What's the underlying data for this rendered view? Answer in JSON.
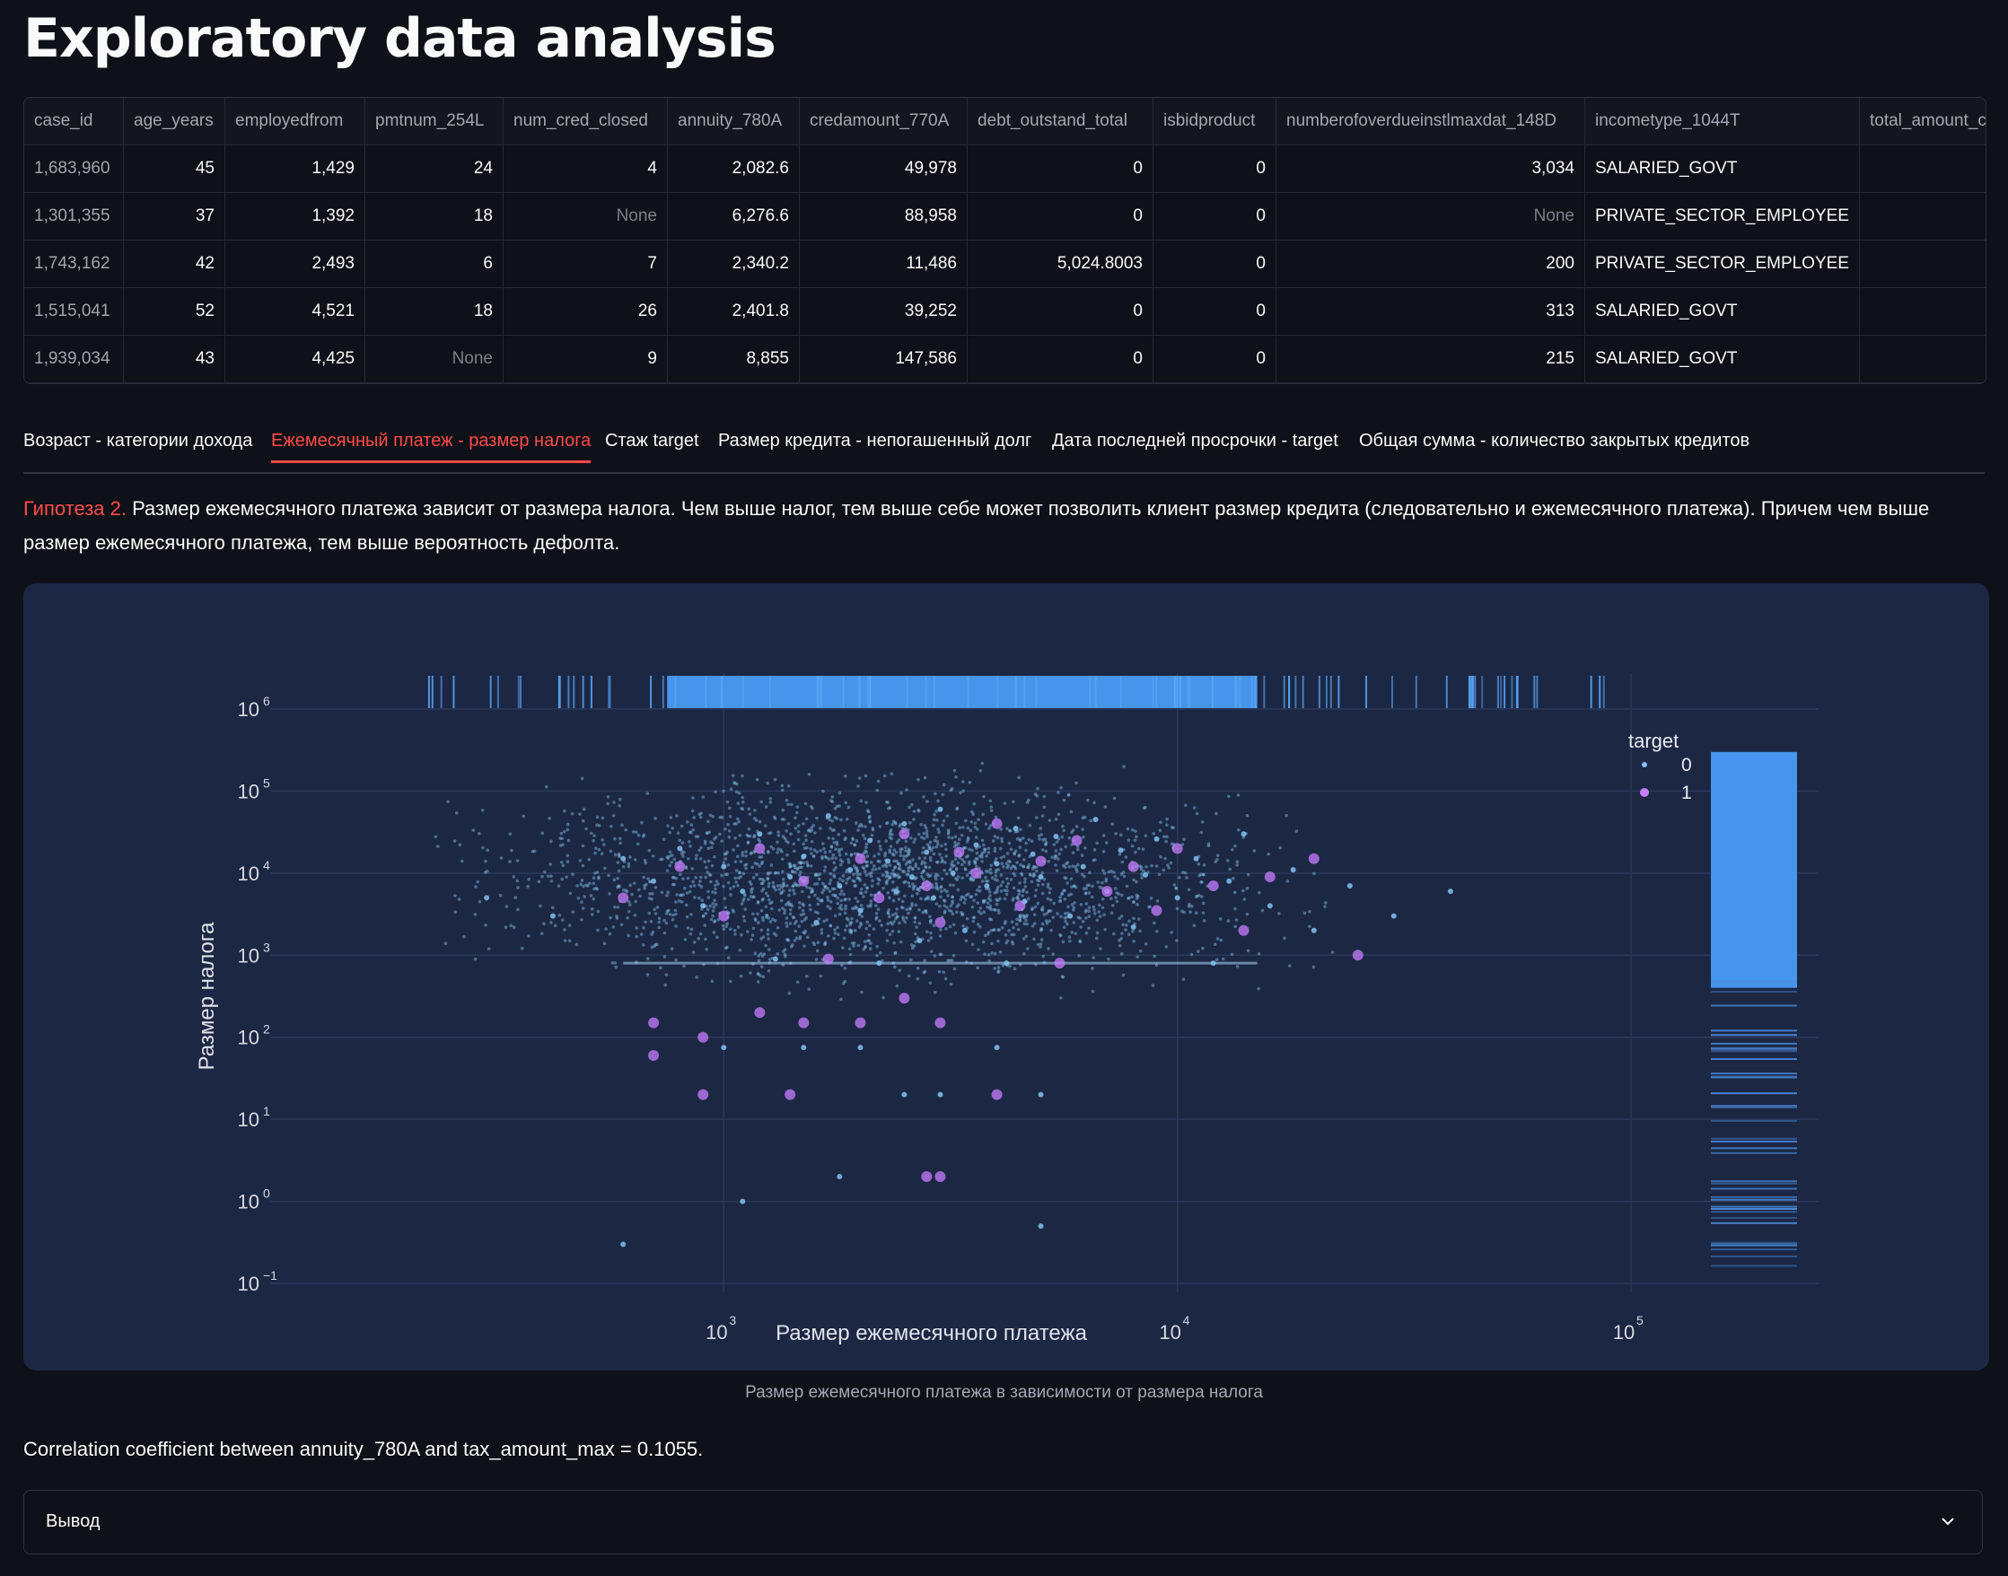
{
  "page": {
    "title": "Exploratory data analysis"
  },
  "table": {
    "columns": [
      "case_id",
      "age_years",
      "employedfrom",
      "pmtnum_254L",
      "num_cred_closed",
      "annuity_780A",
      "credamount_770A",
      "debt_outstand_total",
      "isbidproduct",
      "numberofoverdueinstlmaxdat_148D",
      "incometype_1044T",
      "total_amount_clos"
    ],
    "rows": [
      [
        "1,683,960",
        "45",
        "1,429",
        "24",
        "4",
        "2,082.6",
        "49,978",
        "0",
        "0",
        "3,034",
        "SALARIED_GOVT",
        ""
      ],
      [
        "1,301,355",
        "37",
        "1,392",
        "18",
        "None",
        "6,276.6",
        "88,958",
        "0",
        "0",
        "None",
        "PRIVATE_SECTOR_EMPLOYEE",
        ""
      ],
      [
        "1,743,162",
        "42",
        "2,493",
        "6",
        "7",
        "2,340.2",
        "11,486",
        "5,024.8003",
        "0",
        "200",
        "PRIVATE_SECTOR_EMPLOYEE",
        ""
      ],
      [
        "1,515,041",
        "52",
        "4,521",
        "18",
        "26",
        "2,401.8",
        "39,252",
        "0",
        "0",
        "313",
        "SALARIED_GOVT",
        ""
      ],
      [
        "1,939,034",
        "43",
        "4,425",
        "None",
        "9",
        "8,855",
        "147,586",
        "0",
        "0",
        "215",
        "SALARIED_GOVT",
        ""
      ]
    ]
  },
  "tabs": [
    {
      "label": "Возраст - категории дохода",
      "active": false
    },
    {
      "label": "Ежемесячный платеж - размер налога",
      "active": true
    },
    {
      "label": "Стаж target",
      "active": false
    },
    {
      "label": "Размер кредита - непогашенный долг",
      "active": false
    },
    {
      "label": "Дата последней просрочки - target",
      "active": false
    },
    {
      "label": "Общая сумма - количество закрытых кредитов",
      "active": false
    }
  ],
  "hypothesis": {
    "label": "Гипотеза 2.",
    "text": " Размер ежемесячного платежа зависит от размера налога. Чем выше налог, тем выше себе может позволить клиент размер кредита (следовательно и ежемесячного платежа). Причем чем выше размер ежемесячного платежа, тем выше вероятность дефолта."
  },
  "chart_data": {
    "type": "scatter",
    "xlabel": "Размер ежемесячного платежа",
    "ylabel": "Размер налога",
    "x_scale": "log",
    "y_scale": "log",
    "xlim": [
      100,
      150000
    ],
    "ylim": [
      0.1,
      1000000
    ],
    "x_ticks": [
      {
        "base": "10",
        "exp": "3",
        "v": 1000
      },
      {
        "base": "10",
        "exp": "4",
        "v": 10000
      },
      {
        "base": "10",
        "exp": "5",
        "v": 100000
      }
    ],
    "y_ticks": [
      {
        "base": "10",
        "exp": "6",
        "v": 1000000
      },
      {
        "base": "10",
        "exp": "5",
        "v": 100000
      },
      {
        "base": "10",
        "exp": "4",
        "v": 10000
      },
      {
        "base": "10",
        "exp": "3",
        "v": 1000
      },
      {
        "base": "10",
        "exp": "2",
        "v": 100
      },
      {
        "base": "10",
        "exp": "1",
        "v": 10
      },
      {
        "base": "10",
        "exp": "0",
        "v": 1
      },
      {
        "base": "10",
        "exp": "−1",
        "v": 0.1
      }
    ],
    "legend": {
      "title": "target",
      "position": "top-right"
    },
    "series": [
      {
        "name": "0",
        "color": "#7fc3ee",
        "points": [
          [
            300,
            5000
          ],
          [
            420,
            3000
          ],
          [
            600,
            15000
          ],
          [
            700,
            8000
          ],
          [
            800,
            20000
          ],
          [
            900,
            4000
          ],
          [
            1000,
            12000
          ],
          [
            1100,
            6000
          ],
          [
            1200,
            30000
          ],
          [
            1300,
            900
          ],
          [
            1400,
            9000
          ],
          [
            1500,
            16000
          ],
          [
            1600,
            2500
          ],
          [
            1700,
            50000
          ],
          [
            1800,
            7000
          ],
          [
            1900,
            11000
          ],
          [
            2000,
            3500
          ],
          [
            2100,
            25000
          ],
          [
            2200,
            800
          ],
          [
            2300,
            14000
          ],
          [
            2400,
            6000
          ],
          [
            2500,
            40000
          ],
          [
            2600,
            9000
          ],
          [
            2700,
            1500
          ],
          [
            2800,
            18000
          ],
          [
            2900,
            5000
          ],
          [
            3000,
            60000
          ],
          [
            3200,
            10000
          ],
          [
            3400,
            2000
          ],
          [
            3600,
            22000
          ],
          [
            3800,
            7000
          ],
          [
            4000,
            13000
          ],
          [
            4200,
            800
          ],
          [
            4400,
            35000
          ],
          [
            4600,
            4500
          ],
          [
            4800,
            17000
          ],
          [
            5000,
            9000
          ],
          [
            5400,
            28000
          ],
          [
            5800,
            3000
          ],
          [
            6200,
            12000
          ],
          [
            6600,
            45000
          ],
          [
            7000,
            6000
          ],
          [
            7500,
            19000
          ],
          [
            8000,
            2200
          ],
          [
            8500,
            9500
          ],
          [
            9000,
            26000
          ],
          [
            10000,
            5000
          ],
          [
            11000,
            15000
          ],
          [
            12000,
            800
          ],
          [
            13000,
            8000
          ],
          [
            14000,
            30000
          ],
          [
            16000,
            4000
          ],
          [
            18000,
            11000
          ],
          [
            20000,
            2000
          ],
          [
            24000,
            7000
          ],
          [
            30000,
            3000
          ],
          [
            40000,
            6000
          ],
          [
            1000,
            75
          ],
          [
            1500,
            75
          ],
          [
            2000,
            75
          ],
          [
            2500,
            20
          ],
          [
            3000,
            20
          ],
          [
            4000,
            75
          ],
          [
            5000,
            20
          ],
          [
            1800,
            2
          ],
          [
            600,
            0.3
          ],
          [
            1100,
            1
          ],
          [
            5000,
            0.5
          ]
        ]
      },
      {
        "name": "1",
        "color": "#c77dff",
        "points": [
          [
            600,
            5000
          ],
          [
            800,
            12000
          ],
          [
            1000,
            3000
          ],
          [
            1200,
            20000
          ],
          [
            1500,
            8000
          ],
          [
            1700,
            900
          ],
          [
            2000,
            15000
          ],
          [
            2200,
            5000
          ],
          [
            2500,
            30000
          ],
          [
            2800,
            7000
          ],
          [
            3000,
            2500
          ],
          [
            3300,
            18000
          ],
          [
            3600,
            10000
          ],
          [
            4000,
            40000
          ],
          [
            4500,
            4000
          ],
          [
            5000,
            14000
          ],
          [
            5500,
            800
          ],
          [
            6000,
            25000
          ],
          [
            7000,
            6000
          ],
          [
            8000,
            12000
          ],
          [
            9000,
            3500
          ],
          [
            10000,
            20000
          ],
          [
            12000,
            7000
          ],
          [
            14000,
            2000
          ],
          [
            16000,
            9000
          ],
          [
            20000,
            15000
          ],
          [
            25000,
            1000
          ],
          [
            700,
            150
          ],
          [
            900,
            100
          ],
          [
            1200,
            200
          ],
          [
            1500,
            150
          ],
          [
            2000,
            150
          ],
          [
            2500,
            300
          ],
          [
            3000,
            150
          ],
          [
            2800,
            2
          ],
          [
            3000,
            2
          ],
          [
            900,
            20
          ],
          [
            1400,
            20
          ],
          [
            4000,
            20
          ],
          [
            700,
            60
          ]
        ]
      }
    ]
  },
  "caption": "Размер ежемесячного платежа в зависимости от размера налога",
  "correlation": "Correlation coefficient between annuity_780A and tax_amount_max = 0.1055.",
  "expander": {
    "title": "Вывод"
  }
}
